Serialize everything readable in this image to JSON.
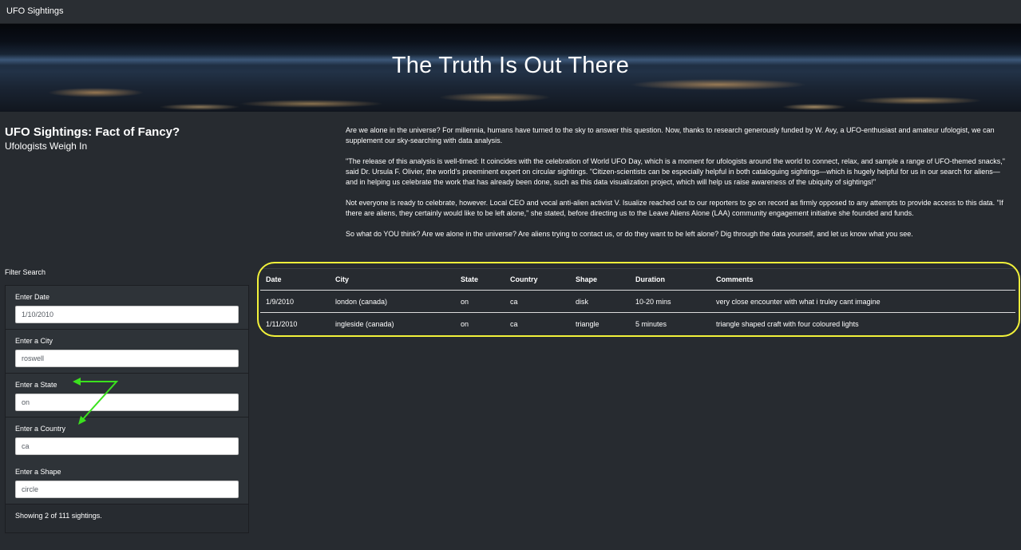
{
  "navbar": {
    "brand": "UFO Sightings"
  },
  "hero": {
    "title": "The Truth Is Out There"
  },
  "header": {
    "headline": "UFO Sightings: Fact of Fancy?",
    "subheadline": "Ufologists Weigh In"
  },
  "article": {
    "paragraphs": [
      "Are we alone in the universe? For millennia, humans have turned to the sky to answer this question. Now, thanks to research generously funded by W. Avy, a UFO-enthusiast and amateur ufologist, we can supplement our sky-searching with data analysis.",
      "\"The release of this analysis is well-timed: It coincides with the celebration of World UFO Day, which is a moment for ufologists around the world to connect, relax, and sample a range of UFO-themed snacks,\" said Dr. Ursula F. Olivier, the world's preeminent expert on circular sightings. \"Citizen-scientists can be especially helpful in both cataloguing sightings—which is hugely helpful for us in our search for aliens—and in helping us celebrate the work that has already been done, such as this data visualization project, which will help us raise awareness of the ubiquity of sightings!\"",
      "Not everyone is ready to celebrate, however. Local CEO and vocal anti-alien activist V. Isualize reached out to our reporters to go on record as firmly opposed to any attempts to provide access to this data. \"If there are aliens, they certainly would like to be left alone,\" she stated, before directing us to the Leave Aliens Alone (LAA) community engagement initiative she founded and funds.",
      "So what do YOU think? Are we alone in the universe? Are aliens trying to contact us, or do they want to be left alone? Dig through the data yourself, and let us know what you see."
    ]
  },
  "filters": {
    "title": "Filter Search",
    "date": {
      "label": "Enter Date",
      "value": "1/10/2010"
    },
    "city": {
      "label": "Enter a City",
      "value": "roswell"
    },
    "state": {
      "label": "Enter a State",
      "value": "on"
    },
    "country": {
      "label": "Enter a Country",
      "value": "ca"
    },
    "shape": {
      "label": "Enter a Shape",
      "value": "circle"
    },
    "status": "Showing 2 of 111 sightings."
  },
  "table": {
    "headers": [
      "Date",
      "City",
      "State",
      "Country",
      "Shape",
      "Duration",
      "Comments"
    ],
    "rows": [
      [
        "1/9/2010",
        "london (canada)",
        "on",
        "ca",
        "disk",
        "10-20 mins",
        "very close encounter with what i truley cant imagine"
      ],
      [
        "1/11/2010",
        "ingleside (canada)",
        "on",
        "ca",
        "triangle",
        "5 minutes",
        "triangle shaped craft with four coloured lights"
      ]
    ]
  },
  "annotations": {
    "ring_color": "#f2f23a",
    "arrow_color": "#3be21e"
  }
}
